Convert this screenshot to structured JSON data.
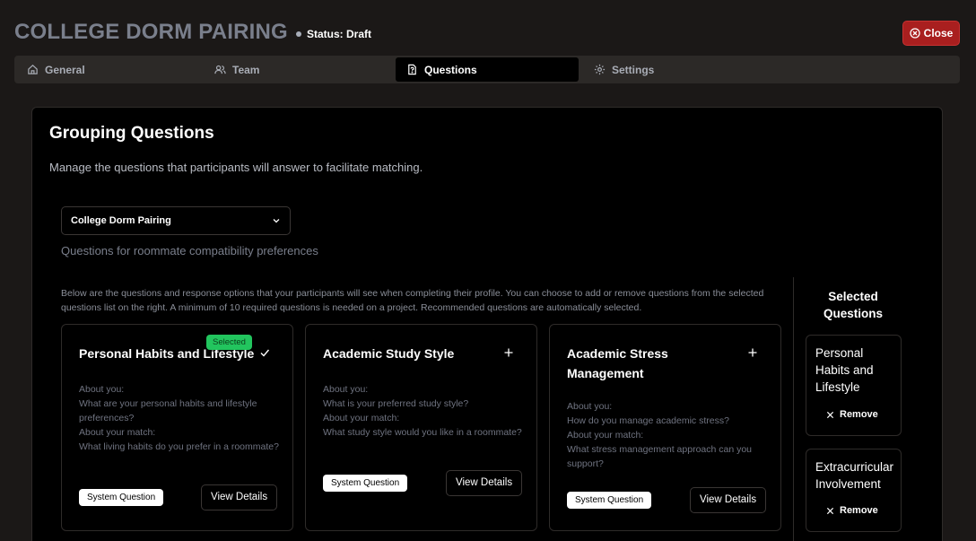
{
  "header": {
    "title": "COLLEGE DORM PAIRING",
    "status": "Status: Draft",
    "close_label": "Close"
  },
  "tabs": [
    {
      "label": "General",
      "icon": "home-icon"
    },
    {
      "label": "Team",
      "icon": "users-icon"
    },
    {
      "label": "Questions",
      "icon": "file-question-icon",
      "active": true
    },
    {
      "label": "Settings",
      "icon": "gear-icon"
    }
  ],
  "main": {
    "title": "Grouping Questions",
    "description": "Manage the questions that participants will answer to facilitate matching.",
    "question_set": {
      "selected": "College Dorm Pairing",
      "description": "Questions for roommate compatibility preferences"
    },
    "intro": "Below are the questions and response options that your participants will see when completing their profile. You can choose to add or remove questions from the selected questions list on the right. A minimum of 10 required questions is needed on a project. Recommended questions are automatically selected."
  },
  "questions": [
    {
      "title": "Personal Habits and Lifestyle",
      "selected": true,
      "badge": "Selected",
      "about_you_label": "About you:",
      "about_you": "What are your personal habits and lifestyle preferences?",
      "about_match_label": "About your match:",
      "about_match": "What living habits do you prefer in a roommate?",
      "type": "System Question",
      "details_label": "View Details"
    },
    {
      "title": "Academic Study Style",
      "selected": false,
      "about_you_label": "About you:",
      "about_you": "What is your preferred study style?",
      "about_match_label": "About your match:",
      "about_match": "What study style would you like in a roommate?",
      "type": "System Question",
      "details_label": "View Details"
    },
    {
      "title": "Academic Stress Management",
      "selected": false,
      "about_you_label": "About you:",
      "about_you": "How do you manage academic stress?",
      "about_match_label": "About your match:",
      "about_match": "What stress management approach can you support?",
      "type": "System Question",
      "details_label": "View Details"
    }
  ],
  "selected_panel": {
    "heading": "Selected Questions",
    "items": [
      {
        "title": "Personal Habits and Lifestyle",
        "remove_label": "Remove"
      },
      {
        "title": "Extracurricular Involvement",
        "remove_label": "Remove"
      }
    ]
  },
  "colors": {
    "accent_close": "#a91f1f",
    "selected_badge": "#22c55e"
  }
}
